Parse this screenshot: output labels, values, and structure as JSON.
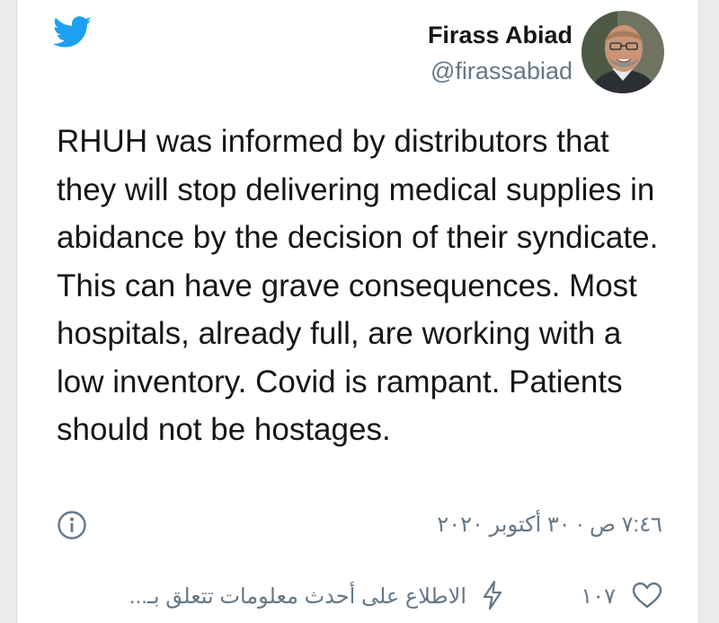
{
  "author": {
    "name": "Firass Abiad",
    "handle": "@firassabiad"
  },
  "tweet": {
    "text": "RHUH was informed by distributors that they will stop delivering medical supplies in abidance by the decision of their syndicate. This can have grave consequences. Most hospitals, already full, are working with a low inventory. Covid is rampant. Patients should not be hostages."
  },
  "meta": {
    "timestamp": "٧:٤٦ ص · ٣٠ أكتوبر ٢٠٢٠"
  },
  "actions": {
    "like_count": "١٠٧",
    "info_link": "الاطلاع على أحدث معلومات تتعلق بـ..."
  },
  "icons": {
    "brand": "twitter-bird-icon",
    "info": "info-icon",
    "bolt": "bolt-icon",
    "like": "heart-icon"
  },
  "colors": {
    "brand_blue": "#1da1f2",
    "text_primary": "#14171a",
    "text_secondary": "#657786"
  }
}
